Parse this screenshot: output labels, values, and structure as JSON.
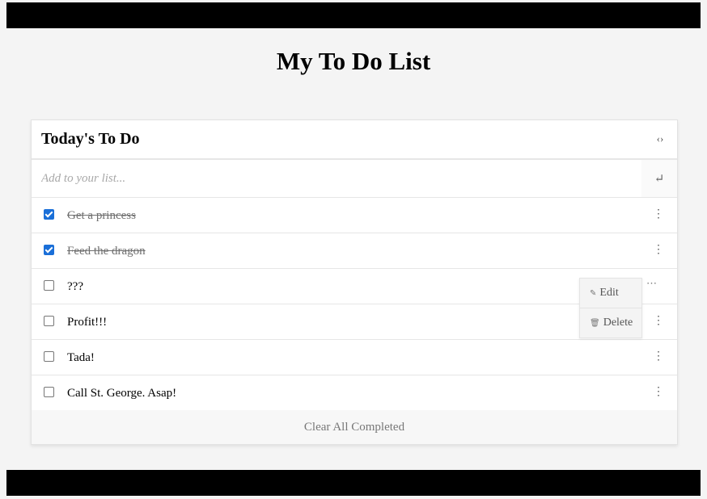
{
  "page": {
    "title": "My To Do List"
  },
  "card": {
    "title": "Today's To Do",
    "sync_icon": "sync-icon",
    "input": {
      "placeholder": "Add to your list...",
      "value": ""
    },
    "enter_icon": "enter-icon",
    "items": [
      {
        "text": "Get a princess",
        "done": true
      },
      {
        "text": "Feed the dragon",
        "done": true
      },
      {
        "text": "???",
        "done": false
      },
      {
        "text": "Profit!!!",
        "done": false
      },
      {
        "text": "Tada!",
        "done": false
      },
      {
        "text": "Call St. George. Asap!",
        "done": false
      }
    ],
    "clear_label": "Clear All Completed"
  },
  "context_menu": {
    "edit_label": "Edit",
    "delete_label": "Delete",
    "edit_icon": "edit-icon",
    "delete_icon": "trash-icon"
  },
  "colors": {
    "checkbox_checked": "#1a6fd8",
    "bars": "#000000",
    "background": "#f4f4f4"
  }
}
